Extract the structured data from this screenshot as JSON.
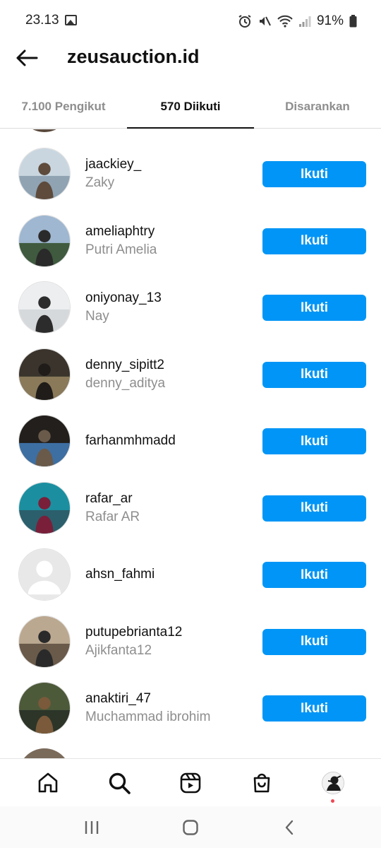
{
  "status_bar": {
    "time": "23.13",
    "battery": "91%"
  },
  "header": {
    "title": "zeusauction.id"
  },
  "tabs": [
    {
      "label": "7.100 Pengikut"
    },
    {
      "label": "570 Diikuti"
    },
    {
      "label": "Disarankan"
    }
  ],
  "follow_label": "Ikuti",
  "users": [
    {
      "username": "jaackiey_",
      "fullname": "Zaky",
      "avatar_colors": [
        "#c9d6df",
        "#8fa3b3",
        "#5e4b3c"
      ]
    },
    {
      "username": "ameliaphtry",
      "fullname": "Putri Amelia",
      "avatar_colors": [
        "#9fb7d0",
        "#3f5a3e",
        "#2a2a2a"
      ]
    },
    {
      "username": "oniyonay_13",
      "fullname": "Nay",
      "avatar_colors": [
        "#eceef0",
        "#d6d9dc",
        "#2c2c2c"
      ]
    },
    {
      "username": "denny_sipitt2",
      "fullname": "denny_aditya",
      "avatar_colors": [
        "#3a342c",
        "#8a7a5a",
        "#1f1c19"
      ]
    },
    {
      "username": "farhanmhmadd",
      "fullname": "",
      "avatar_colors": [
        "#221f1c",
        "#3d6fa3",
        "#6a5a4a"
      ]
    },
    {
      "username": "rafar_ar",
      "fullname": "Rafar AR",
      "avatar_colors": [
        "#1b8fa0",
        "#2b5f6b",
        "#7a1f3a"
      ]
    },
    {
      "username": "ahsn_fahmi",
      "fullname": "",
      "avatar_colors": [
        "#e8e8e8",
        "#ffffff",
        "#ffffff"
      ]
    },
    {
      "username": "putupebrianta12",
      "fullname": "Ajikfanta12",
      "avatar_colors": [
        "#bba890",
        "#6a5a4a",
        "#2a2a2a"
      ]
    },
    {
      "username": "anaktiri_47",
      "fullname": "Muchammad ibrohim",
      "avatar_colors": [
        "#4d5a3a",
        "#2c3528",
        "#7a5a3a"
      ]
    }
  ],
  "icons": {
    "back": "arrow-left-icon",
    "home": "home-icon",
    "search": "search-icon",
    "reels": "reels-icon",
    "shop": "shop-icon",
    "profile": "profile-icon",
    "recents": "recents-icon",
    "sys_home": "system-home-icon",
    "sys_back": "system-back-icon"
  },
  "colors": {
    "accent": "#0095f6",
    "notification_dot": "#ed4956"
  }
}
